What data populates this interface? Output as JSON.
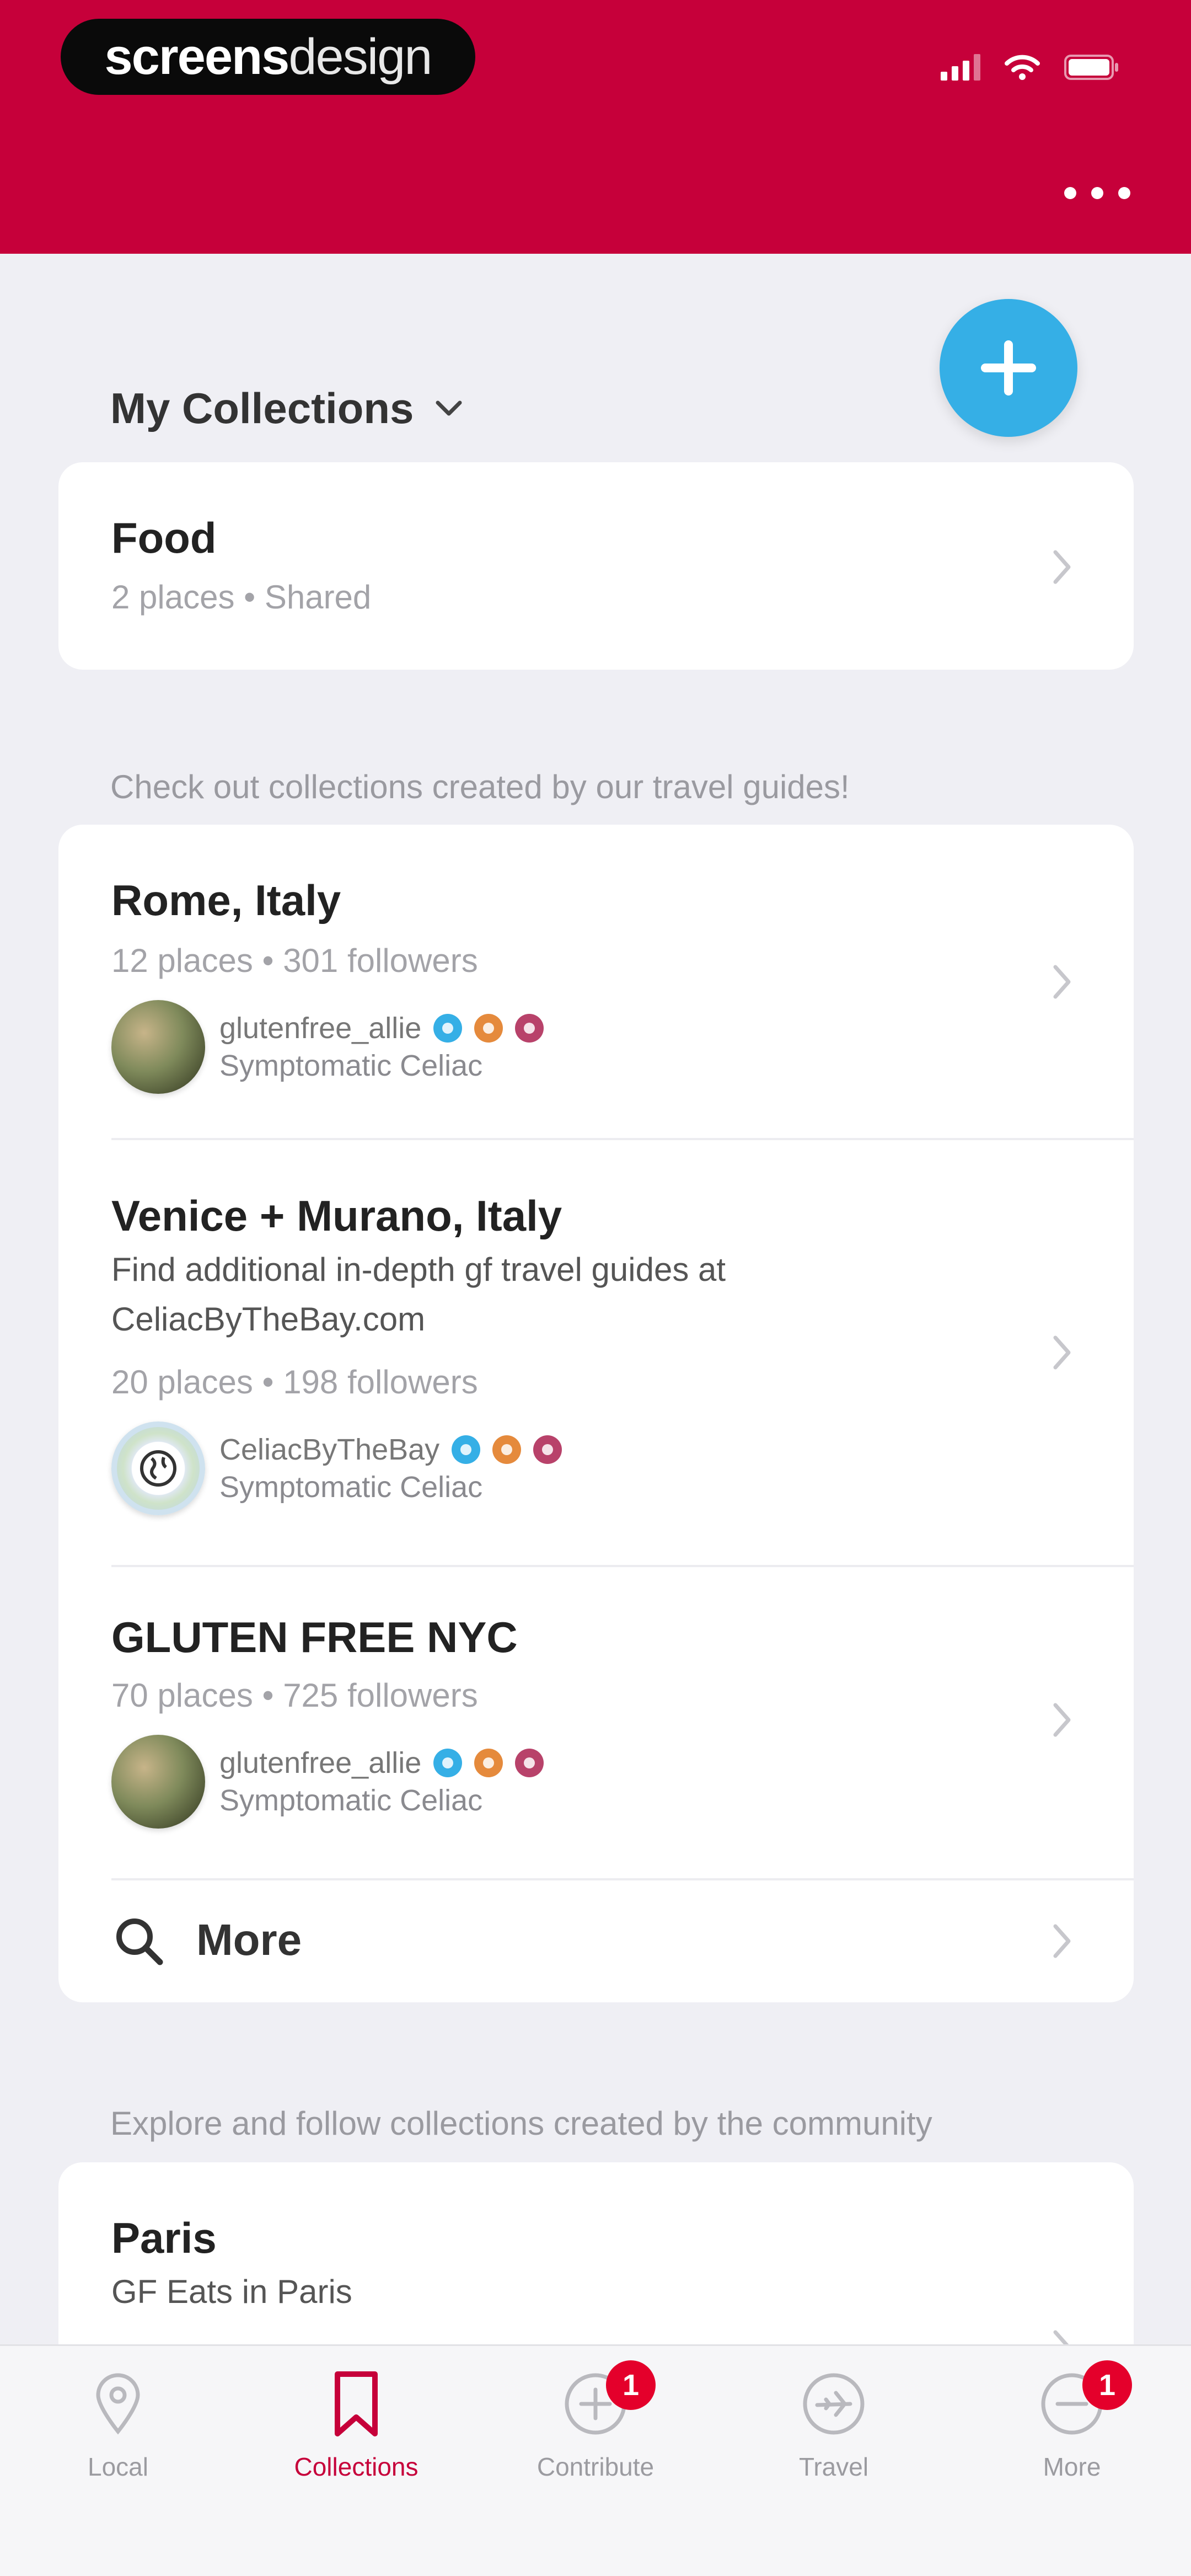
{
  "status_bar": {
    "brand_bold": "screens",
    "brand_light": "design"
  },
  "header": {
    "menu_icon": "more-horizontal-icon"
  },
  "fab": {
    "icon": "plus-icon",
    "color": "#35afe6"
  },
  "my_collections": {
    "title": "My Collections",
    "items": [
      {
        "title": "Food",
        "meta": "2 places • Shared"
      }
    ]
  },
  "guides": {
    "hint": "Check out collections created by our travel guides!",
    "items": [
      {
        "title": "Rome, Italy",
        "meta": "12 places • 301 followers",
        "author": "glutenfree_allie",
        "role": "Symptomatic Celiac"
      },
      {
        "title": "Venice + Murano, Italy",
        "description": "Find additional in-depth gf travel guides at CeliacByTheBay.com",
        "meta": "20 places • 198 followers",
        "author": "CeliacByTheBay",
        "role": "Symptomatic Celiac"
      },
      {
        "title": "GLUTEN FREE NYC",
        "meta": "70 places • 725 followers",
        "author": "glutenfree_allie",
        "role": "Symptomatic Celiac"
      }
    ],
    "more_label": "More"
  },
  "community": {
    "hint": "Explore and follow collections created by the community",
    "items": [
      {
        "title": "Paris",
        "description": "GF Eats in Paris"
      }
    ]
  },
  "tabbar": {
    "active_color": "#c6003a",
    "tabs": [
      {
        "label": "Local",
        "icon": "map-pin-icon"
      },
      {
        "label": "Collections",
        "icon": "bookmark-icon",
        "active": true
      },
      {
        "label": "Contribute",
        "icon": "plus-circle-icon",
        "badge": "1"
      },
      {
        "label": "Travel",
        "icon": "plane-circle-icon"
      },
      {
        "label": "More",
        "icon": "more-circle-icon",
        "badge": "1"
      }
    ]
  }
}
